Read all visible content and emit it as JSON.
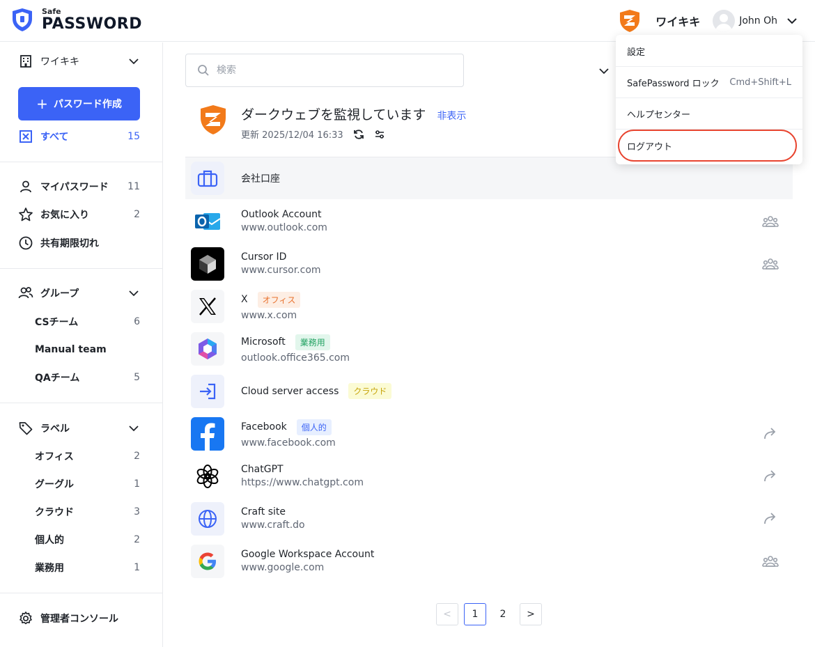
{
  "app": {
    "logo_small": "Safe",
    "logo_big": "PASSWORD"
  },
  "header": {
    "org": "ワイキキ",
    "user": "John Oh"
  },
  "sidebar": {
    "org": "ワイキキ",
    "create_label": "パスワード作成",
    "all": {
      "label": "すべて",
      "count": "15"
    },
    "personal": [
      {
        "label": "マイパスワード",
        "count": "11"
      },
      {
        "label": "お気に入り",
        "count": "2"
      },
      {
        "label": "共有期限切れ",
        "count": ""
      }
    ],
    "groups_title": "グループ",
    "groups": [
      {
        "label": "CSチーム",
        "count": "6"
      },
      {
        "label": "Manual team",
        "count": ""
      },
      {
        "label": "QAチーム",
        "count": "5"
      }
    ],
    "labels_title": "ラベル",
    "labels": [
      {
        "label": "オフィス",
        "count": "2"
      },
      {
        "label": "グーグル",
        "count": "1"
      },
      {
        "label": "クラウド",
        "count": "3"
      },
      {
        "label": "個人的",
        "count": "2"
      },
      {
        "label": "業務用",
        "count": "1"
      }
    ],
    "admin": "管理者コンソール"
  },
  "search": {
    "placeholder": "検索"
  },
  "darkweb": {
    "title": "ダークウェブを監視しています",
    "hide": "非表示",
    "updated": "更新 2025/12/04 16:33"
  },
  "category": {
    "label": "会社口座"
  },
  "items": [
    {
      "name": "Outlook Account",
      "url": "www.outlook.com",
      "tag": "",
      "action": "group-icon"
    },
    {
      "name": "Cursor ID",
      "url": "www.cursor.com",
      "tag": "",
      "action": "group-icon"
    },
    {
      "name": "X",
      "url": "www.x.com",
      "tag": "オフィス",
      "action": ""
    },
    {
      "name": "Microsoft",
      "url": "outlook.office365.com",
      "tag": "業務用",
      "action": ""
    },
    {
      "name": "Cloud server access",
      "url": "",
      "tag": "クラウド",
      "action": ""
    },
    {
      "name": "Facebook",
      "url": "www.facebook.com",
      "tag": "個人的",
      "action": "share-icon"
    },
    {
      "name": "ChatGPT",
      "url": "https://www.chatgpt.com",
      "tag": "",
      "action": "share-icon"
    },
    {
      "name": "Craft site",
      "url": "www.craft.do",
      "tag": "",
      "action": "share-icon"
    },
    {
      "name": "Google Workspace Account",
      "url": "www.google.com",
      "tag": "",
      "action": "group-icon"
    }
  ],
  "pagination": {
    "prev": "<",
    "pages": [
      "1",
      "2"
    ],
    "next": ">"
  },
  "menu": {
    "settings": "設定",
    "lock": "SafePassword ロック",
    "lock_shortcut": "Cmd+Shift+L",
    "help": "ヘルプセンター",
    "logout": "ログアウト"
  },
  "colors": {
    "accent": "#3b63f6",
    "brand_orange": "#f27a1a",
    "highlight_ring": "#e8442f"
  }
}
